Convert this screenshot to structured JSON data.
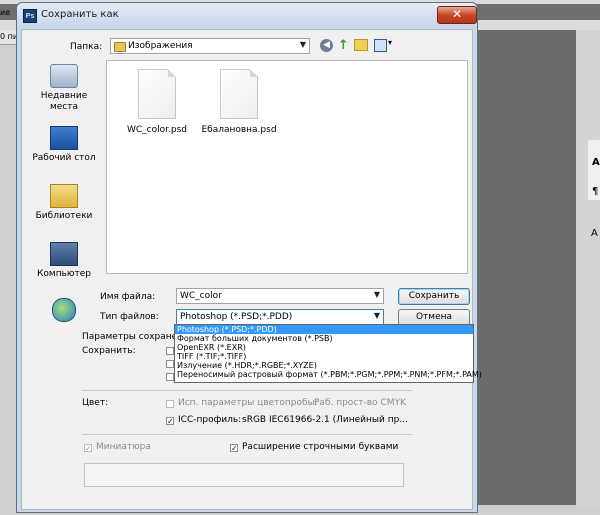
{
  "background_app": {
    "fragment_top": "ие",
    "fragment_left": "0 пи",
    "fragment_right_1": "A",
    "fragment_right_2": "¶",
    "fragment_right_3": "A"
  },
  "dialog": {
    "app_icon_label": "Ps",
    "title": "Сохранить как",
    "close_glyph": "✕",
    "folder_label": "Папка:",
    "folder_value": "Изображения",
    "places": [
      {
        "label": "Недавние места"
      },
      {
        "label": "Рабочий стол"
      },
      {
        "label": "Библиотеки"
      },
      {
        "label": "Компьютер"
      },
      {
        "label": ""
      }
    ],
    "files": [
      {
        "name": "WC_color.psd"
      },
      {
        "name": "Ебалановна.psd"
      }
    ],
    "filename_label": "Имя файла:",
    "filename_value": "WC_color",
    "filetype_label": "Тип файлов:",
    "filetype_value": "Photoshop (*.PSD;*.PDD)",
    "save_button": "Сохранить",
    "cancel_button": "Отмена",
    "filetype_options": [
      "Photoshop (*.PSD;*.PDD)",
      "Формат больших документов (*.PSB)",
      "OpenEXR (*.EXR)",
      "TIFF (*.TIF;*.TIFF)",
      "Излучение (*.HDR;*.RGBE;*.XYZE)",
      "Переносимый растровый формат (*.PBM;*.PGM;*.PPM;*.PNM;*.PFM;*.PAM)"
    ],
    "save_params_label": "Параметры сохране",
    "save_label": "Сохранить:",
    "color_label": "Цвет:",
    "proof_setup_label": "Исп. параметры цветопробы:",
    "proof_setup_value": "Раб. прост-во CMYK",
    "icc_label": "ICC-профиль:",
    "icc_value": "sRGB IEC61966-2.1 (Линейный пр...",
    "thumbnail_label": "Миниатюра",
    "lowercase_ext_label": "Расширение строчными буквами"
  },
  "colors": {
    "selection": "#3399ff",
    "dialog_frame": "#c9d7e6",
    "close_button": "#c6472a"
  },
  "icons": [
    "photoshop-app-icon",
    "close-icon",
    "folder-icon",
    "back-icon",
    "up-folder-icon",
    "new-folder-icon",
    "view-menu-icon",
    "recent-places-icon",
    "desktop-icon",
    "libraries-icon",
    "computer-icon",
    "network-icon",
    "document-icon",
    "chevron-down-icon",
    "checkbox-icon"
  ]
}
